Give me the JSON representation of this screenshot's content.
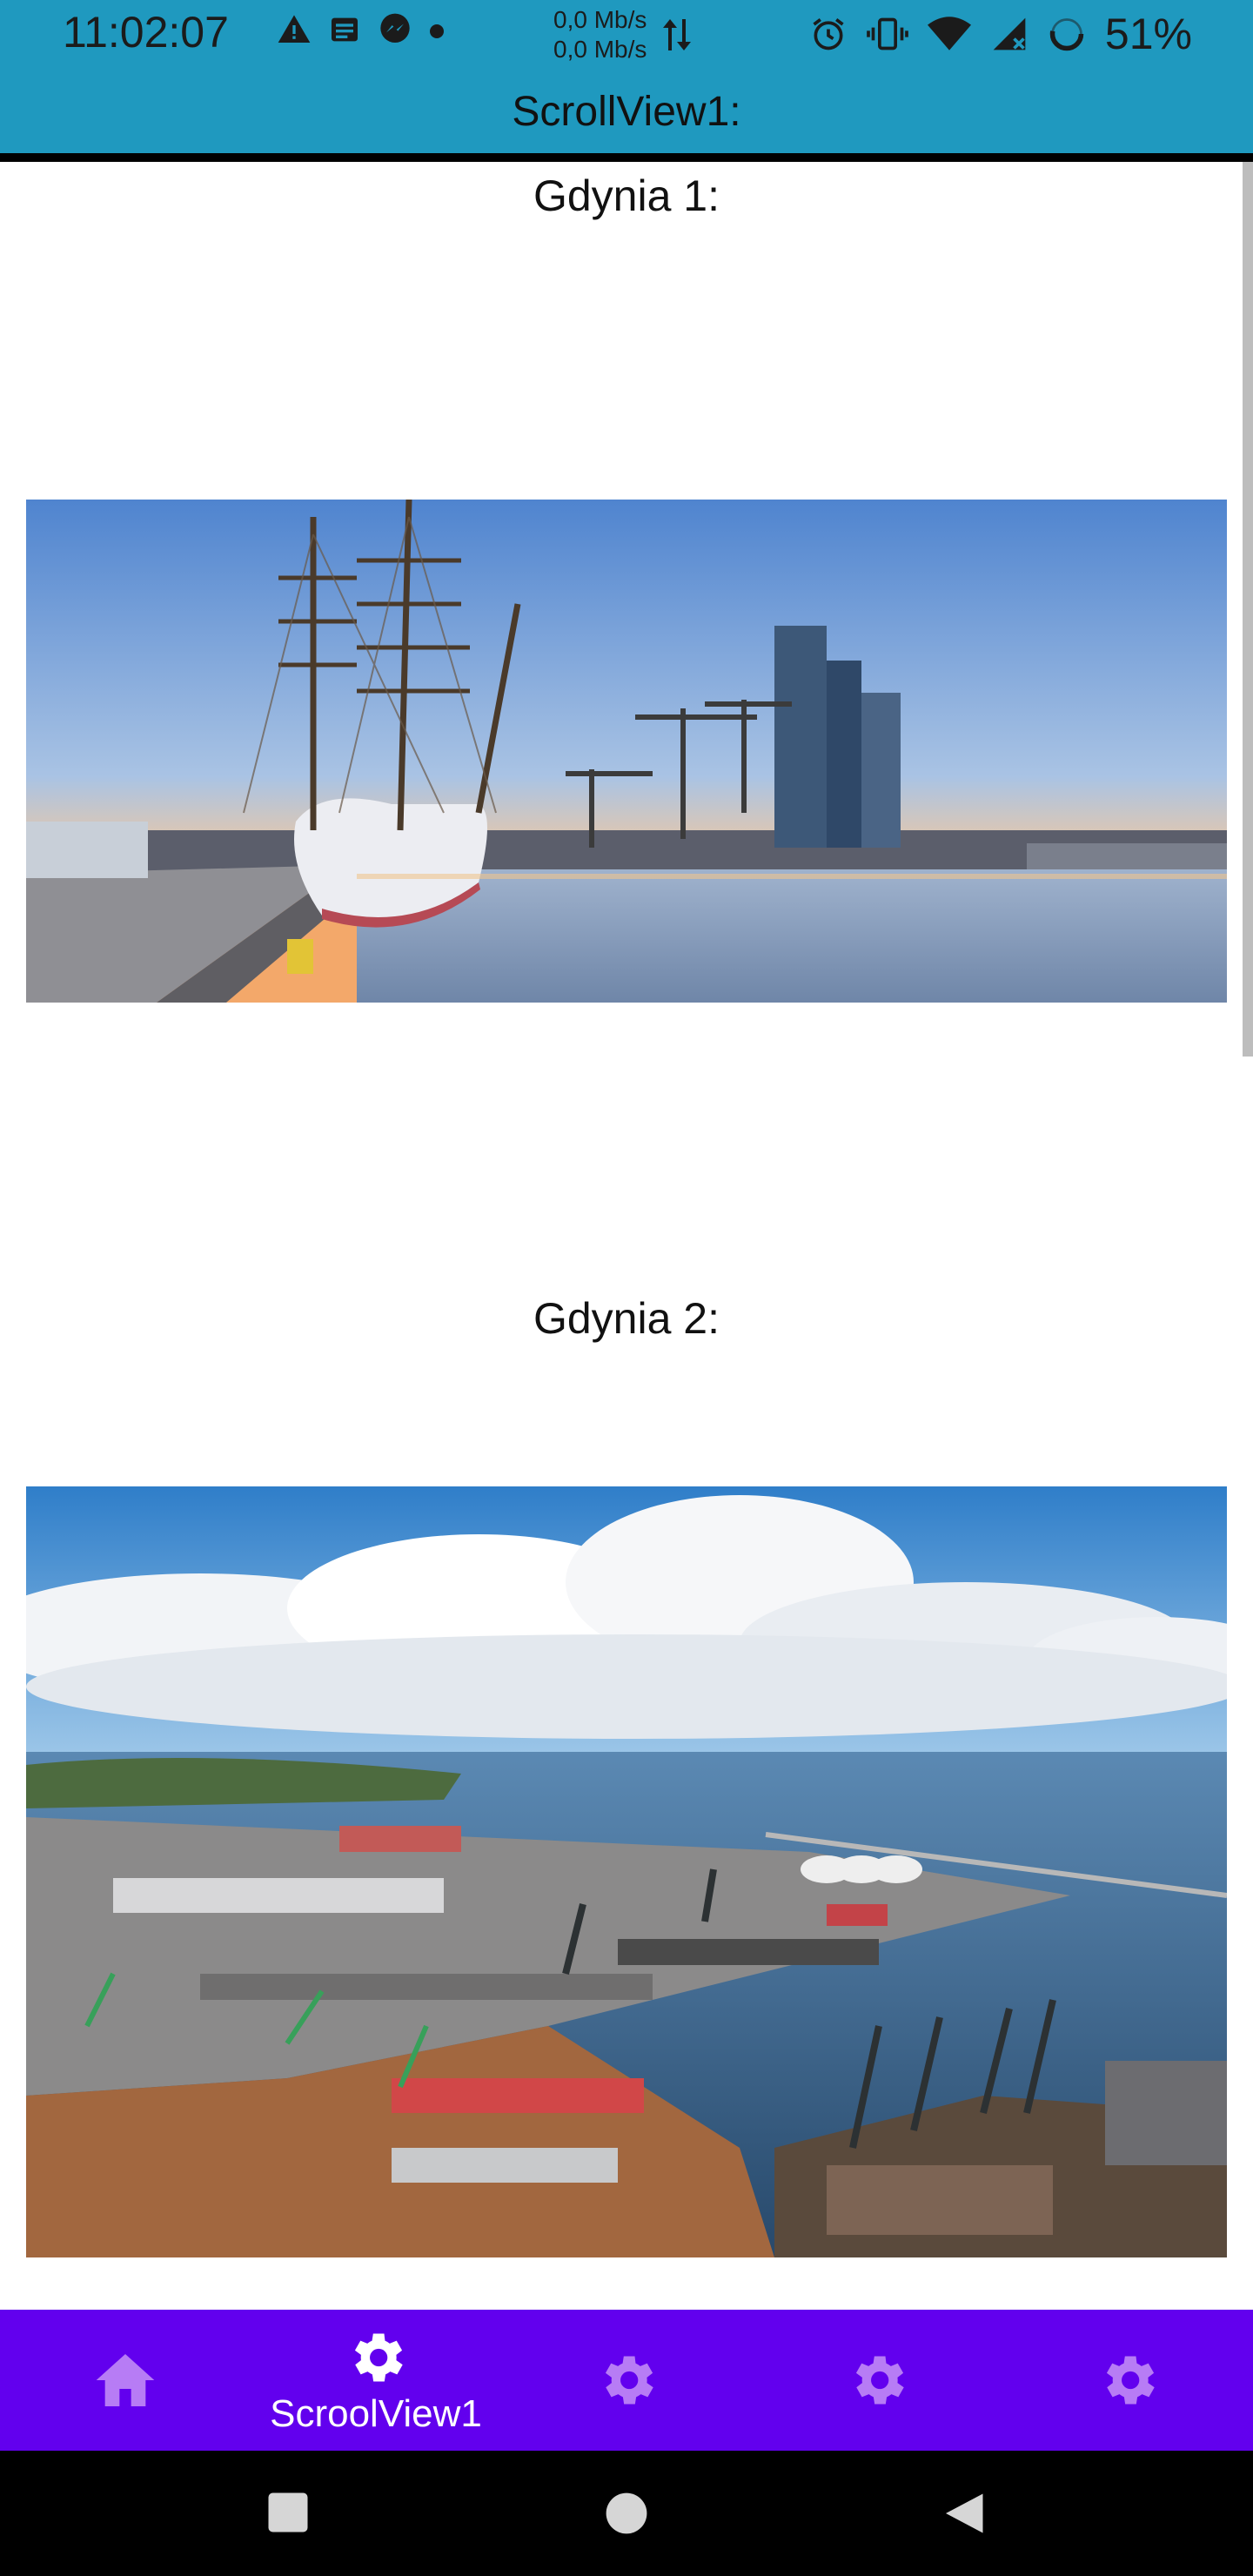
{
  "status_bar": {
    "time": "11:02:07",
    "speed_up": "0,0 Mb/s",
    "speed_down": "0,0 Mb/s",
    "battery": "51%",
    "icons": [
      "warning-icon",
      "news-icon",
      "messenger-icon",
      "dot-icon",
      "alarm-icon",
      "vibrate-icon",
      "wifi-icon",
      "signal-icon",
      "battery-icon"
    ]
  },
  "app_bar": {
    "title": "ScrollView1:"
  },
  "sections": [
    {
      "title": "Gdynia 1:",
      "image": "gdynia-harbor-sailing-ship-photo"
    },
    {
      "title": "Gdynia 2:",
      "image": "gdynia-port-aerial-photo"
    }
  ],
  "bottom_nav": {
    "active_index": 1,
    "items": [
      {
        "icon": "home-icon",
        "label": ""
      },
      {
        "icon": "gear-icon",
        "label": "ScroolView1"
      },
      {
        "icon": "gear-icon",
        "label": ""
      },
      {
        "icon": "gear-icon",
        "label": ""
      },
      {
        "icon": "gear-icon",
        "label": ""
      }
    ]
  },
  "colors": {
    "status_bar": "#1f99bf",
    "bottom_nav": "#6200ee",
    "nav_icon_inactive": "#b77cf5",
    "nav_icon_active": "#ffffff"
  }
}
